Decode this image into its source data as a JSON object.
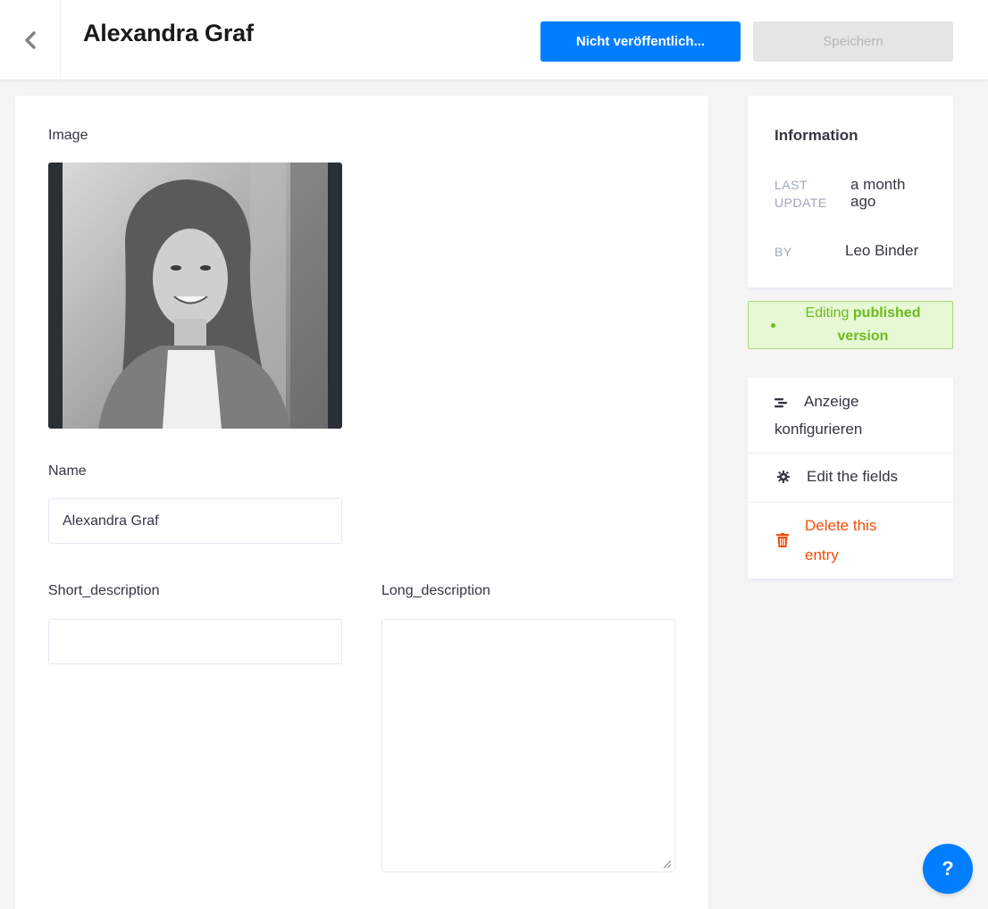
{
  "header": {
    "title": "Alexandra Graf",
    "publish_label": "Nicht veröffentlich...",
    "save_label": "Speichern"
  },
  "form": {
    "image_label": "Image",
    "name_label": "Name",
    "name_value": "Alexandra Graf",
    "short_description_label": "Short_description",
    "short_description_value": "",
    "long_description_label": "Long_description",
    "long_description_value": ""
  },
  "information": {
    "title": "Information",
    "last_update_key_line1": "LAST",
    "last_update_key_line2": "UPDATE",
    "last_update_value_line1": "a month",
    "last_update_value_line2": "ago",
    "by_key": "BY",
    "by_value": "Leo Binder"
  },
  "status": {
    "prefix": "Editing",
    "bold": "published",
    "suffix": "version"
  },
  "actions": {
    "configure_line1": "Anzeige",
    "configure_line2": "konfigurieren",
    "edit_fields": "Edit the fields",
    "delete_line1": "Delete this",
    "delete_line2": "entry"
  },
  "help": {
    "label": "?"
  },
  "colors": {
    "primary": "#007eff",
    "success_bg": "#e6f8d4",
    "success_text": "#6dbb1a",
    "danger": "#f64d0a"
  },
  "icons": {
    "back": "chevron-left-icon",
    "configure": "list-icon",
    "edit_fields": "gear-icon",
    "delete": "trash-icon"
  }
}
